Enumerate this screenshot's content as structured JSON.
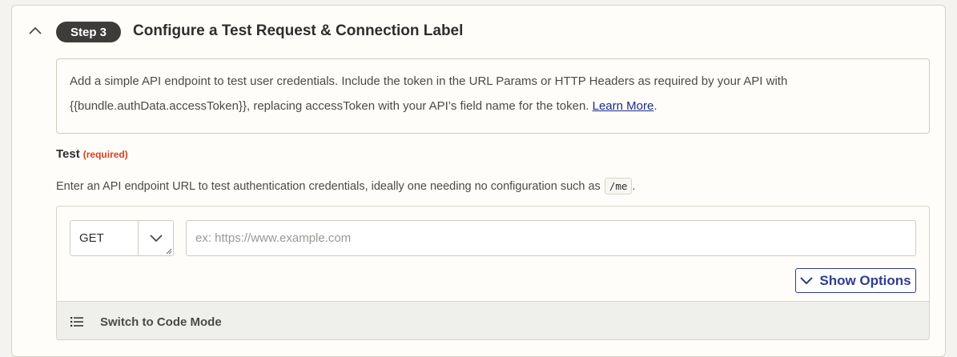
{
  "step": {
    "badge": "Step 3",
    "title": "Configure a Test Request & Connection Label"
  },
  "info": {
    "line1": "Add a simple API endpoint to test user credentials. Include the token in the URL Params or HTTP Headers as required by your API with",
    "line2": "{{bundle.authData.accessToken}}, replacing accessToken with your API’s field name for the token. ",
    "link": "Learn More",
    "period": "."
  },
  "test_field": {
    "label": "Test",
    "required": "(required)",
    "help": "Enter an API endpoint URL to test authentication credentials, ideally one needing no configuration such as",
    "help_code": "/me",
    "help_end": "."
  },
  "request": {
    "method": "GET",
    "url_value": "",
    "url_placeholder": "ex: https://www.example.com",
    "show_options_label": "Show Options",
    "code_mode_label": "Switch to Code Mode"
  },
  "icons": {
    "collapse": "chevron-up-icon",
    "method_dropdown": "chevron-down-icon",
    "show_options": "chevron-down-icon",
    "code_mode": "list-icon"
  },
  "colors": {
    "accent": "#2f3d91",
    "required": "#d4421f",
    "badge_bg": "#3d3c3a",
    "link": "#1a2a8c"
  }
}
